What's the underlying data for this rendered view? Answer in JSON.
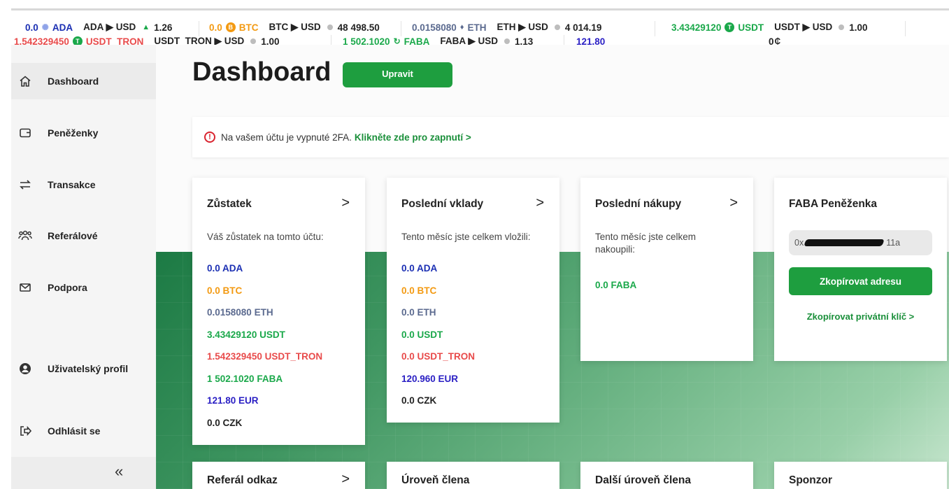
{
  "ticker": {
    "row1": [
      {
        "amount": "0.0",
        "coin": "ADA",
        "icon": "ada-icon",
        "pair": "ADA ▶ USD",
        "trend": "▲",
        "rate": "1.26",
        "color": "#1b2fb3",
        "icon_color": "#8fa3e8"
      },
      {
        "amount": "0.0",
        "coin": "BTC",
        "icon": "btc-icon",
        "pair": "BTC ▶ USD",
        "trend": "●",
        "rate": "48 498.50",
        "color": "#f39a12",
        "icon_color": "#f39a12"
      },
      {
        "amount": "0.0158080",
        "coin": "ETH",
        "icon": "eth-icon",
        "pair": "ETH ▶ USD",
        "trend": "●",
        "rate": "4 014.19",
        "color": "#5b6a8f",
        "icon_color": "#5b6a8f"
      },
      {
        "amount": "3.43429120",
        "coin": "USDT",
        "icon": "usdt-icon",
        "pair": "USDT ▶ USD",
        "trend": "●",
        "rate": "1.00",
        "color": "#1aa84a",
        "icon_color": "#1aa84a"
      }
    ],
    "row2": [
      {
        "amount": "1.542329450",
        "coin": "USDT_TRON",
        "icon": "usdt-icon",
        "pair": "USDT_TRON ▶ USD",
        "trend": "●",
        "rate": "1.00",
        "color": "#e84a4a",
        "icon_color": "#1aa84a"
      },
      {
        "amount": "1 502.1020",
        "coin": "FABA",
        "icon": "faba-icon",
        "pair": "FABA ▶ USD",
        "trend": "●",
        "rate": "1.13",
        "color": "#1aa84a",
        "icon_color": "#1aa84a"
      }
    ],
    "eur_total": "121.80",
    "czk_total": "0",
    "czk_icon": "czk-icon"
  },
  "sidebar": {
    "items": [
      {
        "label": "Dashboard",
        "icon": "home-icon"
      },
      {
        "label": "Peněženky",
        "icon": "wallet-icon"
      },
      {
        "label": "Transakce",
        "icon": "transfer-arrows-icon"
      },
      {
        "label": "Referálové",
        "icon": "people-icon"
      },
      {
        "label": "Podpora",
        "icon": "envelope-icon"
      },
      {
        "label": "Uživatelský profil",
        "icon": "user-icon"
      },
      {
        "label": "Odhlásit se",
        "icon": "logout-icon"
      }
    ],
    "collapse_icon": "double-chevron-left-icon"
  },
  "main": {
    "title": "Dashboard",
    "edit_label": "Upravit",
    "alert": {
      "text": "Na vašem účtu je vypnuté 2FA.",
      "link": "Klikněte zde pro zapnutí >"
    },
    "cards": {
      "balance": {
        "title": "Zůstatek",
        "subtitle": "Váš zůstatek na tomto účtu:",
        "items": [
          "0.0 ADA",
          "0.0 BTC",
          "0.0158080 ETH",
          "3.43429120 USDT",
          "1.542329450 USDT_TRON",
          "1 502.1020 FABA",
          "121.80 EUR",
          "0.0 CZK"
        ]
      },
      "deposits": {
        "title": "Poslední vklady",
        "subtitle": "Tento měsíc jste celkem vložili:",
        "items": [
          "0.0 ADA",
          "0.0 BTC",
          "0.0 ETH",
          "0.0 USDT",
          "0.0 USDT_TRON",
          "120.960 EUR",
          "0.0 CZK"
        ]
      },
      "purchases": {
        "title": "Poslední nákupy",
        "subtitle": "Tento měsíc jste celkem nakoupili:",
        "items": [
          "0.0 FABA"
        ]
      },
      "faba_wallet": {
        "title": "FABA Peněženka",
        "address_start": "0x",
        "address_end": "11a",
        "copy_address": "Zkopírovat adresu",
        "copy_key": "Zkopírovat privátní klíč >"
      },
      "bottom": [
        "Referál odkaz",
        "Úroveň člena",
        "Další úroveň člena",
        "Sponzor"
      ]
    },
    "arrow": ">"
  },
  "colors": {
    "accent_green": "#1e9e3f",
    "link_green": "#1a8f3a",
    "alert_red": "#d9232e",
    "ada_blue": "#1b2fb3",
    "btc_orange": "#f39a12",
    "eth_slate": "#5b6a8f",
    "usdt_green": "#1aa84a",
    "tron_red": "#e84a4a",
    "eur_indigo": "#2a1fc4"
  }
}
